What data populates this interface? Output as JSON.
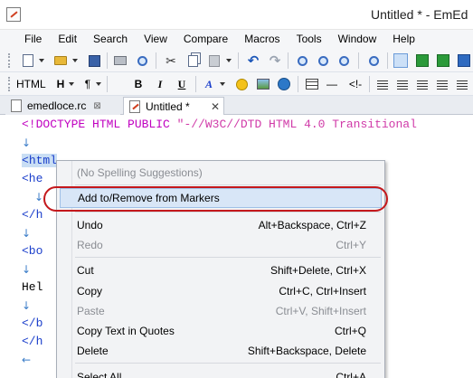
{
  "window": {
    "title": "Untitled * - EmEd"
  },
  "menubar": {
    "items": [
      "File",
      "Edit",
      "Search",
      "View",
      "Compare",
      "Macros",
      "Tools",
      "Window",
      "Help"
    ]
  },
  "toolbar2": {
    "html_label": "HTML",
    "heading_label": "H",
    "para_label": "¶",
    "bold_label": "B",
    "italic_label": "I",
    "underline_label": "U",
    "font_label": "A",
    "hr_label": "—",
    "comment_label": "<!-"
  },
  "tabs": [
    {
      "label": "emedloce.rc",
      "active": false
    },
    {
      "label": "Untitled *",
      "active": true
    }
  ],
  "editor": {
    "line1_a": "<!DOCTYPE HTML PUBLIC ",
    "line1_b": "\"-//W3C//DTD HTML 4.0 Transitional",
    "newline_mark": "↓",
    "lt": "<",
    "selected_word": "html",
    "frag_head": "<he",
    "frag_close_h1": "</h",
    "frag_body": "<bo",
    "frag_hello": "Hel",
    "frag_close_b": "</b",
    "frag_close_h2": "</h",
    "eof_mark": "←"
  },
  "context_menu": {
    "items": [
      {
        "label": "(No Spelling Suggestions)",
        "shortcut": "",
        "disabled": true
      },
      {
        "label": "Add to/Remove from Markers",
        "shortcut": "",
        "disabled": false,
        "highlighted": true
      },
      {
        "label": "Undo",
        "shortcut": "Alt+Backspace, Ctrl+Z",
        "disabled": false
      },
      {
        "label": "Redo",
        "shortcut": "Ctrl+Y",
        "disabled": true
      },
      {
        "label": "Cut",
        "shortcut": "Shift+Delete, Ctrl+X",
        "disabled": false
      },
      {
        "label": "Copy",
        "shortcut": "Ctrl+C, Ctrl+Insert",
        "disabled": false
      },
      {
        "label": "Paste",
        "shortcut": "Ctrl+V, Shift+Insert",
        "disabled": true
      },
      {
        "label": "Copy Text in Quotes",
        "shortcut": "Ctrl+Q",
        "disabled": false
      },
      {
        "label": "Delete",
        "shortcut": "Shift+Backspace, Delete",
        "disabled": false
      },
      {
        "label": "Select All",
        "shortcut": "Ctrl+A",
        "disabled": false
      }
    ]
  },
  "colors": {
    "annotation_oval": "#c4181c",
    "highlight": "#d8e6f7",
    "doctype": "#c000c0",
    "tag": "#1a3ecb"
  }
}
